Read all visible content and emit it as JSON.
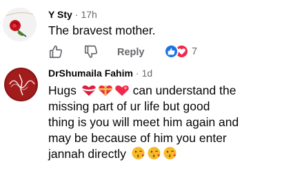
{
  "comments": [
    {
      "author": "Y Sty",
      "time": "17h",
      "text": "The bravest mother.",
      "actions": {
        "reply_label": "Reply",
        "reaction_count": "7",
        "reactions": [
          "like-icon",
          "love-icon"
        ]
      },
      "avatar": "rose-avatar"
    },
    {
      "author": "DrShumaila Fahim",
      "time": "1d",
      "lines": [
        "Hugs",
        "can understand the",
        "missing part of ur life but good",
        "thing is you will meet him again and",
        "may be because of him you enter",
        "jannah directly"
      ],
      "emojis": {
        "after_hugs": [
          "heart-ribbon-icon",
          "heart-gift-icon",
          "sparkling-heart-icon"
        ],
        "after_jannah": [
          "kiss-face-icon",
          "kiss-face-icon",
          "kiss-face-icon"
        ]
      },
      "avatar": "wave-avatar"
    }
  ],
  "separator": "·",
  "colors": {
    "text": "#050505",
    "secondary": "#65676b",
    "like_blue": "#1b74e4",
    "love_red": "#f0284a"
  }
}
